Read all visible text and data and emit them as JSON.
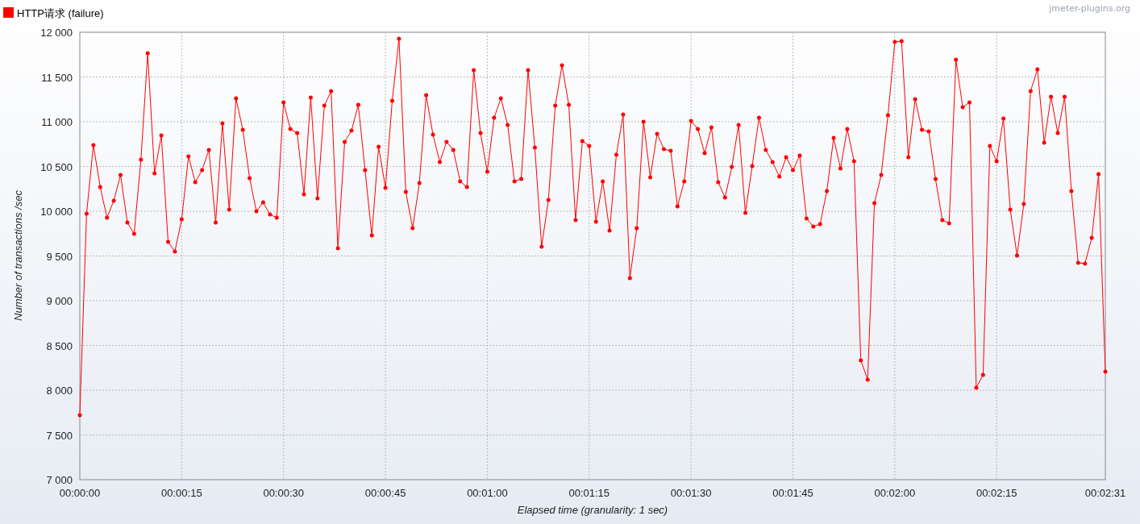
{
  "credit": "jmeter-plugins.org",
  "chart_data": {
    "type": "line",
    "grid": true,
    "xlabel": "Elapsed time (granularity: 1 sec)",
    "ylabel": "Number of transactions /sec",
    "xlim": [
      0,
      151
    ],
    "ylim": [
      7000,
      12000
    ],
    "x": [
      0,
      1,
      2,
      3,
      4,
      5,
      6,
      7,
      8,
      9,
      10,
      11,
      12,
      13,
      14,
      15,
      16,
      17,
      18,
      19,
      20,
      21,
      22,
      23,
      24,
      25,
      26,
      27,
      28,
      29,
      30,
      31,
      32,
      33,
      34,
      35,
      36,
      37,
      38,
      39,
      40,
      41,
      42,
      43,
      44,
      45,
      46,
      47,
      48,
      49,
      50,
      51,
      52,
      53,
      54,
      55,
      56,
      57,
      58,
      59,
      60,
      61,
      62,
      63,
      64,
      65,
      66,
      67,
      68,
      69,
      70,
      71,
      72,
      73,
      74,
      75,
      76,
      77,
      78,
      79,
      80,
      81,
      82,
      83,
      84,
      85,
      86,
      87,
      88,
      89,
      90,
      91,
      92,
      93,
      94,
      95,
      96,
      97,
      98,
      99,
      100,
      101,
      102,
      103,
      104,
      105,
      106,
      107,
      108,
      109,
      110,
      111,
      112,
      113,
      114,
      115,
      116,
      117,
      118,
      119,
      120,
      121,
      122,
      123,
      124,
      125,
      126,
      127,
      128,
      129,
      130,
      131,
      132,
      133,
      134,
      135,
      136,
      137,
      138,
      139,
      140,
      141,
      142,
      143,
      144,
      145,
      146,
      147,
      148,
      149,
      150,
      151
    ],
    "xticks": [
      {
        "value": 0,
        "label": "00:00:00"
      },
      {
        "value": 15,
        "label": "00:00:15"
      },
      {
        "value": 30,
        "label": "00:00:30"
      },
      {
        "value": 45,
        "label": "00:00:45"
      },
      {
        "value": 60,
        "label": "00:01:00"
      },
      {
        "value": 75,
        "label": "00:01:15"
      },
      {
        "value": 90,
        "label": "00:01:30"
      },
      {
        "value": 105,
        "label": "00:01:45"
      },
      {
        "value": 120,
        "label": "00:02:00"
      },
      {
        "value": 135,
        "label": "00:02:15"
      },
      {
        "value": 151,
        "label": "00:02:31"
      }
    ],
    "yticks": [
      {
        "value": 7000,
        "label": "7 000"
      },
      {
        "value": 7500,
        "label": "7 500"
      },
      {
        "value": 8000,
        "label": "8 000"
      },
      {
        "value": 8500,
        "label": "8 500"
      },
      {
        "value": 9000,
        "label": "9 000"
      },
      {
        "value": 9500,
        "label": "9 500"
      },
      {
        "value": 10000,
        "label": "10 000"
      },
      {
        "value": 10500,
        "label": "10 500"
      },
      {
        "value": 11000,
        "label": "11 000"
      },
      {
        "value": 11500,
        "label": "11 500"
      },
      {
        "value": 12000,
        "label": "12 000"
      }
    ],
    "series": [
      {
        "name": "HTTP请求 (failure)",
        "color": "#ff0000",
        "values": [
          7720,
          9973,
          10739,
          10270,
          9928,
          10117,
          10405,
          9874,
          9748,
          10577,
          11766,
          10423,
          10847,
          9658,
          9550,
          9910,
          10613,
          10324,
          10459,
          10685,
          9874,
          10982,
          10018,
          11261,
          10910,
          10369,
          10000,
          10099,
          9964,
          9928,
          11216,
          10919,
          10874,
          10189,
          11270,
          10144,
          11180,
          11342,
          9586,
          10775,
          10901,
          11189,
          10459,
          9730,
          10721,
          10261,
          11234,
          11928,
          10216,
          9811,
          10315,
          11297,
          10856,
          10550,
          10775,
          10685,
          10333,
          10270,
          11577,
          10874,
          10441,
          11045,
          11261,
          10964,
          10333,
          10360,
          11577,
          10712,
          9604,
          10126,
          11180,
          11631,
          11189,
          9901,
          10784,
          10730,
          9883,
          10333,
          9784,
          10631,
          11081,
          9252,
          9811,
          11000,
          10378,
          10865,
          10694,
          10676,
          10054,
          10333,
          11009,
          10919,
          10649,
          10937,
          10324,
          10153,
          10495,
          10964,
          9982,
          10504,
          11045,
          10685,
          10550,
          10387,
          10604,
          10459,
          10622,
          9919,
          9829,
          9856,
          10225,
          10820,
          10477,
          10919,
          10559,
          8333,
          8117,
          10090,
          10405,
          11072,
          11892,
          11901,
          10604,
          11252,
          10910,
          10892,
          10360,
          9901,
          9865,
          11694,
          11162,
          11216,
          8027,
          8171,
          10730,
          10559,
          11036,
          10018,
          9505,
          10081,
          11342,
          11586,
          10766,
          11279,
          10874,
          11279,
          10225,
          9423,
          9414,
          9703,
          10414,
          8207
        ]
      }
    ]
  }
}
